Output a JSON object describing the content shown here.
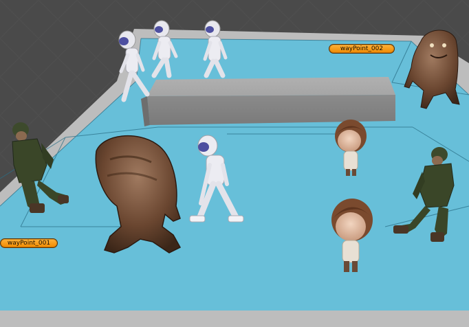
{
  "waypoints": [
    {
      "label": "wayPoint_001"
    },
    {
      "label": "wayPoint_002"
    }
  ],
  "colors": {
    "navmesh": "#66bed8",
    "walkway": "#b9b9b9",
    "obstacle": "#9e9e9e",
    "waypoint_badge": "#f39a14",
    "ground": "#4a4a4a"
  },
  "icons": {
    "robot": "astronaut-robot-icon",
    "soldier": "soldier-icon",
    "monster": "monster-icon",
    "kid": "cartoon-kid-icon"
  }
}
